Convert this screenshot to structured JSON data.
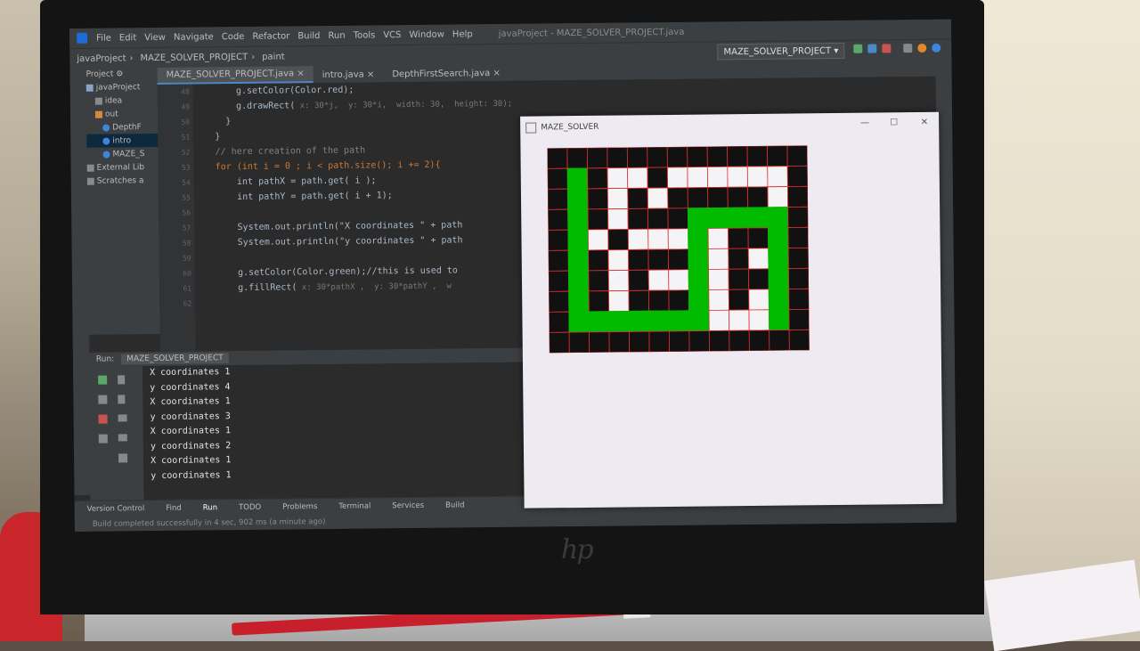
{
  "menubar": {
    "items": [
      "File",
      "Edit",
      "View",
      "Navigate",
      "Code",
      "Refactor",
      "Build",
      "Run",
      "Tools",
      "VCS",
      "Window",
      "Help"
    ],
    "window_title": "javaProject - MAZE_SOLVER_PROJECT.java"
  },
  "navbar": {
    "breadcrumbs": [
      "javaProject",
      "MAZE_SOLVER_PROJECT",
      "paint"
    ],
    "run_config": "MAZE_SOLVER_PROJECT"
  },
  "project_panel": {
    "header": "Project",
    "items": [
      "javaProject",
      "idea",
      "out",
      "DepthF",
      "intro",
      "MAZE_S",
      "External Lib",
      "Scratches a"
    ]
  },
  "tabs": [
    "MAZE_SOLVER_PROJECT.java",
    "intro.java",
    "DepthFirstSearch.java"
  ],
  "gutter": {
    "line_numbers": [
      "48",
      "49",
      "50",
      "51",
      "52",
      "53",
      "54",
      "55",
      "56",
      "57",
      "58",
      "59",
      "60",
      "61",
      "62"
    ]
  },
  "editor": {
    "lines": [
      {
        "code": "        g.setColor(Color.red);"
      },
      {
        "code": "        g.drawRect(",
        "hint": " x: 30*j,  y: 30*i,  width: 30,  height: 30);"
      },
      {
        "code": "      }"
      },
      {
        "code": "    }"
      },
      {
        "code": "    // here creation of the path",
        "cls": "cm"
      },
      {
        "code": "    for (int i = 0 ; i < path.size(); i += 2){"
      },
      {
        "code": "        int pathX = path.get( i );"
      },
      {
        "code": "        int pathY = path.get( i + 1);"
      },
      {
        "code": ""
      },
      {
        "code": "        System.out.println(\"X coordinates \" + path"
      },
      {
        "code": "        System.out.println(\"y coordinates \" + path"
      },
      {
        "code": ""
      },
      {
        "code": "        g.setColor(Color.green);//this is used to"
      },
      {
        "code": "        g.fillRect(",
        "hint": " x: 30*pathX ,  y: 30*pathY ,  w"
      },
      {
        "code": ""
      }
    ]
  },
  "run_panel": {
    "label": "Run:",
    "config": "MAZE_SOLVER_PROJECT"
  },
  "console": {
    "lines": [
      "X coordinates 1",
      "y coordinates 4",
      "X coordinates 1",
      "y coordinates 3",
      "X coordinates 1",
      "y coordinates 2",
      "X coordinates 1",
      "y coordinates 1"
    ]
  },
  "bottom_tabs": [
    "Version Control",
    "Find",
    "Run",
    "TODO",
    "Problems",
    "Terminal",
    "Services",
    "Build"
  ],
  "status": "Build completed successfully in 4 sec, 902 ms (a minute ago)",
  "maze_window": {
    "title": "MAZE_SOLVER",
    "grid": [
      [
        1,
        1,
        1,
        1,
        1,
        1,
        1,
        1,
        1,
        1,
        1,
        1,
        1
      ],
      [
        1,
        0,
        1,
        0,
        0,
        1,
        0,
        0,
        0,
        0,
        0,
        0,
        1
      ],
      [
        1,
        0,
        1,
        0,
        1,
        0,
        1,
        1,
        1,
        1,
        1,
        0,
        1
      ],
      [
        1,
        0,
        1,
        0,
        1,
        1,
        1,
        1,
        1,
        0,
        0,
        0,
        1
      ],
      [
        1,
        0,
        0,
        1,
        0,
        0,
        0,
        1,
        0,
        1,
        1,
        0,
        1
      ],
      [
        1,
        0,
        1,
        0,
        1,
        1,
        1,
        1,
        0,
        1,
        0,
        0,
        1
      ],
      [
        1,
        0,
        1,
        0,
        1,
        0,
        0,
        1,
        0,
        1,
        1,
        0,
        1
      ],
      [
        1,
        0,
        1,
        0,
        1,
        1,
        1,
        1,
        0,
        1,
        0,
        1,
        1
      ],
      [
        1,
        0,
        0,
        0,
        0,
        0,
        0,
        0,
        0,
        0,
        0,
        1,
        1
      ],
      [
        1,
        1,
        1,
        1,
        1,
        1,
        1,
        1,
        1,
        1,
        1,
        1,
        1
      ]
    ],
    "path_cells": [
      [
        1,
        1
      ],
      [
        1,
        2
      ],
      [
        1,
        3
      ],
      [
        1,
        4
      ],
      [
        1,
        5
      ],
      [
        1,
        6
      ],
      [
        1,
        7
      ],
      [
        1,
        8
      ],
      [
        2,
        8
      ],
      [
        3,
        8
      ],
      [
        4,
        8
      ],
      [
        5,
        8
      ],
      [
        6,
        8
      ],
      [
        7,
        8
      ],
      [
        7,
        7
      ],
      [
        7,
        6
      ],
      [
        7,
        5
      ],
      [
        7,
        4
      ],
      [
        7,
        3
      ],
      [
        8,
        3
      ],
      [
        9,
        3
      ],
      [
        10,
        3
      ],
      [
        11,
        3
      ],
      [
        11,
        4
      ],
      [
        11,
        5
      ],
      [
        11,
        6
      ],
      [
        11,
        7
      ],
      [
        11,
        8
      ]
    ],
    "colors": {
      "wall": "#111111",
      "open": "#f4f4f6",
      "path": "#00bb00",
      "grid_line": "#e03030"
    }
  },
  "colors": {
    "ide_bg": "#2b2b2b",
    "panel": "#3c3f41",
    "accent": "#4a88c7"
  }
}
